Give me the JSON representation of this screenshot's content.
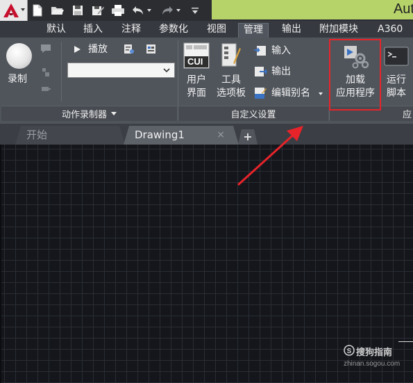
{
  "title_bar": {
    "app_title": "Aut"
  },
  "quick_access": [
    "new-icon",
    "open-icon",
    "save-icon",
    "saveas-icon",
    "plot-icon",
    "undo-icon",
    "redo-icon"
  ],
  "ribbon_tabs": [
    {
      "label": "默认"
    },
    {
      "label": "插入"
    },
    {
      "label": "注释"
    },
    {
      "label": "参数化"
    },
    {
      "label": "视图"
    },
    {
      "label": "管理",
      "active": true
    },
    {
      "label": "输出"
    },
    {
      "label": "附加模块"
    },
    {
      "label": "A360"
    }
  ],
  "panels": {
    "action_recorder": {
      "record_label": "录制",
      "play_label": "播放",
      "footer": "动作录制器"
    },
    "customization": {
      "cui_text": "CUI",
      "user_interface_line1": "用户",
      "user_interface_line2": "界面",
      "tool_palettes_line1": "工具",
      "tool_palettes_line2": "选项板",
      "import_label": "输入",
      "export_label": "输出",
      "edit_aliases_label": "编辑别名",
      "footer": "自定义设置"
    },
    "applications": {
      "load_app_line1": "加载",
      "load_app_line2": "应用程序",
      "run_script_line1": "运行",
      "run_script_line2": "脚本",
      "footer_partial": "应"
    }
  },
  "doc_tabs": {
    "start": "开始",
    "drawing": "Drawing1",
    "close_glyph": "×",
    "add_glyph": "+"
  },
  "watermark": {
    "text": "搜狗指南",
    "url": "zhinan.sogou.com"
  },
  "colors": {
    "highlight_box": "#e8232a",
    "arrow": "#e8232a",
    "title_green": "#b6d36a"
  }
}
